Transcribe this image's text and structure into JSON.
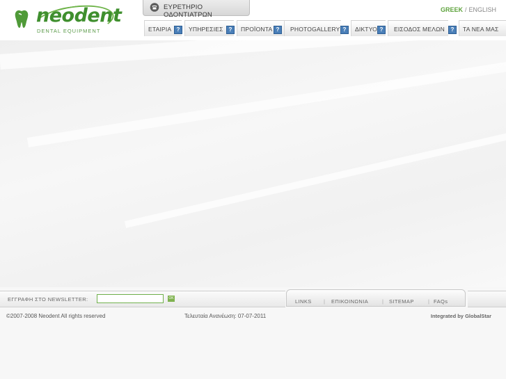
{
  "header": {
    "logo_text": "neodent",
    "logo_subtitle": "DENTAL EQUIPMENT",
    "directory_label": "ΕΥΡΕΤΗΡΙΟ ΟΔΟΝΤΙΑΤΡΩΝ",
    "languages": {
      "greek": "GREEK",
      "separator": "/",
      "english": "ENGLISH",
      "active": "greek"
    }
  },
  "nav": {
    "items": [
      {
        "label": "ΕΤΑΙΡΙΑ"
      },
      {
        "label": "ΥΠΗΡΕΣΙΕΣ"
      },
      {
        "label": "ΠΡΟΪΟΝΤΑ"
      },
      {
        "label": "PHOTOGALLERY"
      },
      {
        "label": "ΔΙΚΤΥΟ"
      },
      {
        "label": "ΕΙΣΟΔΟΣ ΜΕΛΩΝ"
      },
      {
        "label": "ΤΑ ΝΕΑ ΜΑΣ"
      }
    ]
  },
  "footer": {
    "newsletter_label": "ΕΓΓΡΑΦΗ ΣΤΟ NEWSLETTER:",
    "newsletter_value": "",
    "ok_label": "OK",
    "links": [
      {
        "label": "LINKS"
      },
      {
        "label": "ΕΠΙΚΟΙΝΩΝΙΑ"
      },
      {
        "label": "SITEMAP"
      },
      {
        "label": "FAQs"
      }
    ],
    "link_separator": "|",
    "copyright": "©2007-2008 Neodent All rights reserved",
    "updated": "Τελευταία Ανανέωση: 07-07-2011",
    "integrated": "Integrated by GlobalStar"
  },
  "colors": {
    "brand_green": "#3f8f2e",
    "nav_icon_blue": "#4a7fb8"
  }
}
